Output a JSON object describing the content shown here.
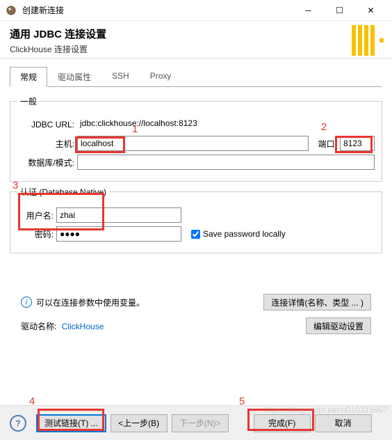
{
  "window": {
    "title": "创建新连接",
    "min_tip": "Minimize",
    "max_tip": "Maximize",
    "close_tip": "Close"
  },
  "header": {
    "title": "通用 JDBC 连接设置",
    "subtitle": "ClickHouse 连接设置"
  },
  "tabs": {
    "general": "常规",
    "driver_props": "驱动属性",
    "ssh": "SSH",
    "proxy": "Proxy"
  },
  "general": {
    "fieldset_label": "一般",
    "jdbc_url_label": "JDBC URL:",
    "jdbc_url": "jdbc:clickhouse://localhost:8123",
    "host_label": "主机:",
    "host": "localhost",
    "port_label": "端口:",
    "port": "8123",
    "dbschema_label": "数据库/模式:",
    "dbschema": ""
  },
  "auth": {
    "fieldset_label": "认证 (Database Native)",
    "user_label": "用户名:",
    "user": "zhai",
    "pass_label": "密码:",
    "pass": "●●●●",
    "save_pass_label": "Save password locally",
    "save_pass_checked": true
  },
  "info": {
    "tip": "可以在连接参数中使用变量。",
    "details_btn": "连接详情(名称、类型 ... )"
  },
  "driver": {
    "name_label": "驱动名称:",
    "name": "ClickHouse",
    "edit_btn": "编辑驱动设置"
  },
  "footer": {
    "test": "测试链接(T) ...",
    "back": "<上一步(B)",
    "next": "下一步(N)>",
    "finish": "完成(F)",
    "cancel": "取消"
  },
  "annotations": {
    "n1": "1",
    "n2": "2",
    "n3": "3",
    "n4": "4",
    "n5": "5"
  },
  "watermark": "https://blog.csdn.net/u010318957"
}
